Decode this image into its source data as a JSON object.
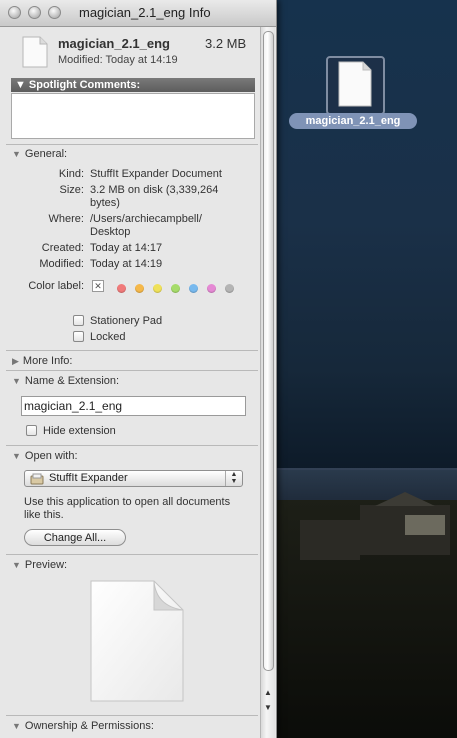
{
  "window": {
    "title": "magician_2.1_eng Info"
  },
  "file": {
    "name": "magician_2.1_eng",
    "size": "3.2 MB",
    "modified_line": "Modified: Today at 14:19"
  },
  "spotlight": {
    "header": "Spotlight Comments:",
    "comments": ""
  },
  "general": {
    "header": "General:",
    "kind_label": "Kind:",
    "kind_value": "StuffIt Expander Document",
    "size_label": "Size:",
    "size_value_1": "3.2 MB on disk (3,339,264",
    "size_value_2": "bytes)",
    "where_label": "Where:",
    "where_value_1": "/Users/archiecampbell/",
    "where_value_2": "Desktop",
    "created_label": "Created:",
    "created_value": "Today at 14:17",
    "modified_label": "Modified:",
    "modified_value": "Today at 14:19",
    "color_label": "Color label:",
    "color_label_none": "✕",
    "colors": [
      "#f07a7a",
      "#f5b84a",
      "#efe15a",
      "#a6dc6a",
      "#78b9ee",
      "#e589d4",
      "#b4b4b4"
    ],
    "stationery_label": "Stationery Pad",
    "locked_label": "Locked"
  },
  "more_info": {
    "header": "More Info:"
  },
  "name_ext": {
    "header": "Name & Extension:",
    "value": "magician_2.1_eng",
    "hide_extension_label": "Hide extension"
  },
  "open_with": {
    "header": "Open with:",
    "app": "StuffIt Expander",
    "description_1": "Use this application to open all documents",
    "description_2": "like this.",
    "change_all": "Change All..."
  },
  "preview": {
    "header": "Preview:"
  },
  "ownership": {
    "header": "Ownership & Permissions:"
  },
  "desktop": {
    "icon_label": "magician_2.1_eng"
  }
}
